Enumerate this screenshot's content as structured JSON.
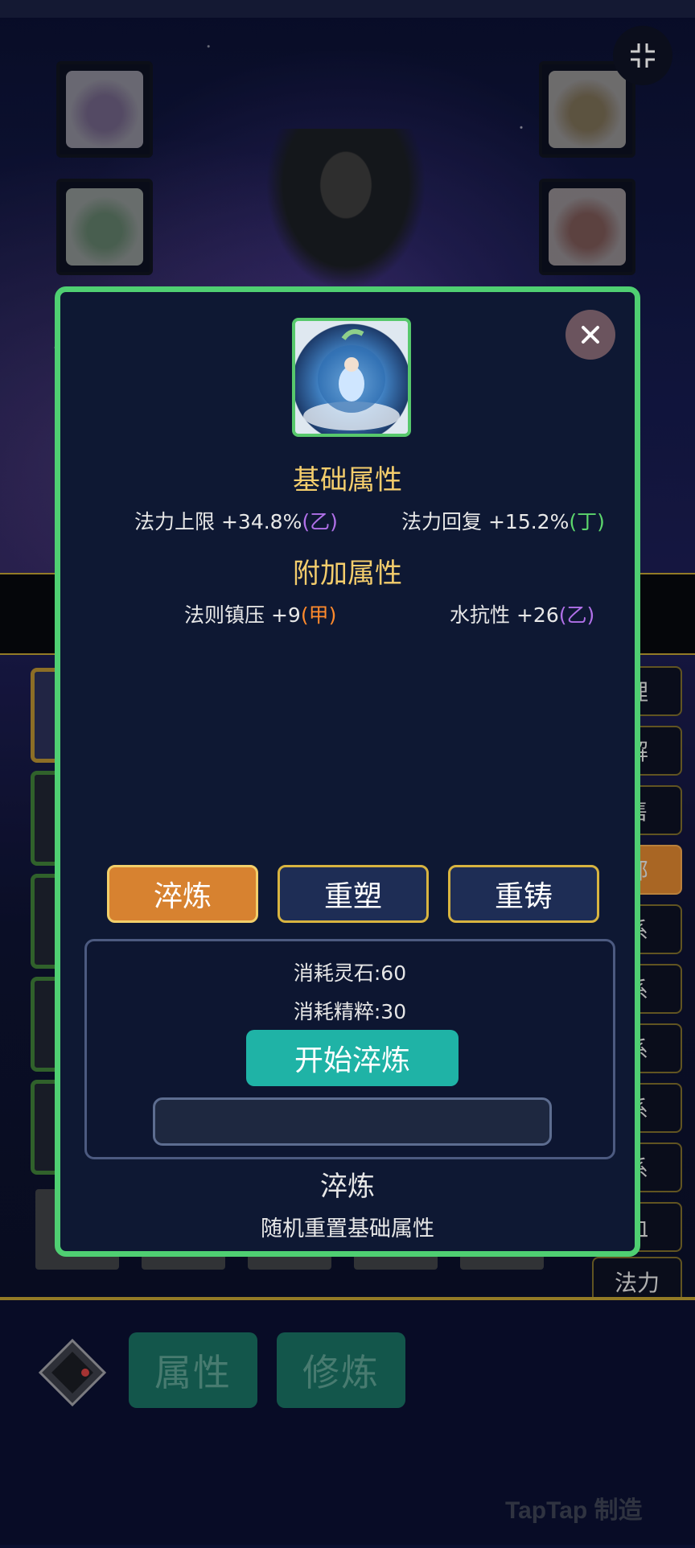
{
  "background": {
    "side_tabs": [
      "理",
      "解",
      "售",
      "部",
      "系",
      "系",
      "系",
      "系",
      "系",
      "血",
      "法力"
    ],
    "active_side_tab_index": 3
  },
  "bottom_nav": {
    "attributes_label": "属性",
    "cultivation_label": "修炼"
  },
  "watermark": "TapTap 制造",
  "modal": {
    "base_title": "基础属性",
    "base_attrs": [
      {
        "name": "法力上限",
        "value": "+34.8%",
        "tier": "(乙)",
        "tier_color": "#b070e8"
      },
      {
        "name": "法力回复",
        "value": "+15.2%",
        "tier": "(丁)",
        "tier_color": "#5cd66c"
      }
    ],
    "extra_title": "附加属性",
    "extra_attrs": [
      {
        "name": "法则镇压",
        "value": "+9",
        "tier": "(甲)",
        "tier_color": "#ff8a2c"
      },
      {
        "name": "水抗性",
        "value": "+26",
        "tier": "(乙)",
        "tier_color": "#b070e8"
      }
    ],
    "actions": [
      {
        "label": "淬炼",
        "active": true
      },
      {
        "label": "重塑",
        "active": false
      },
      {
        "label": "重铸",
        "active": false
      }
    ],
    "cost_stone": "消耗灵石:60",
    "cost_essence": "消耗精粹:30",
    "start_label": "开始淬炼",
    "desc_title": "淬炼",
    "desc_text": "随机重置基础属性"
  }
}
